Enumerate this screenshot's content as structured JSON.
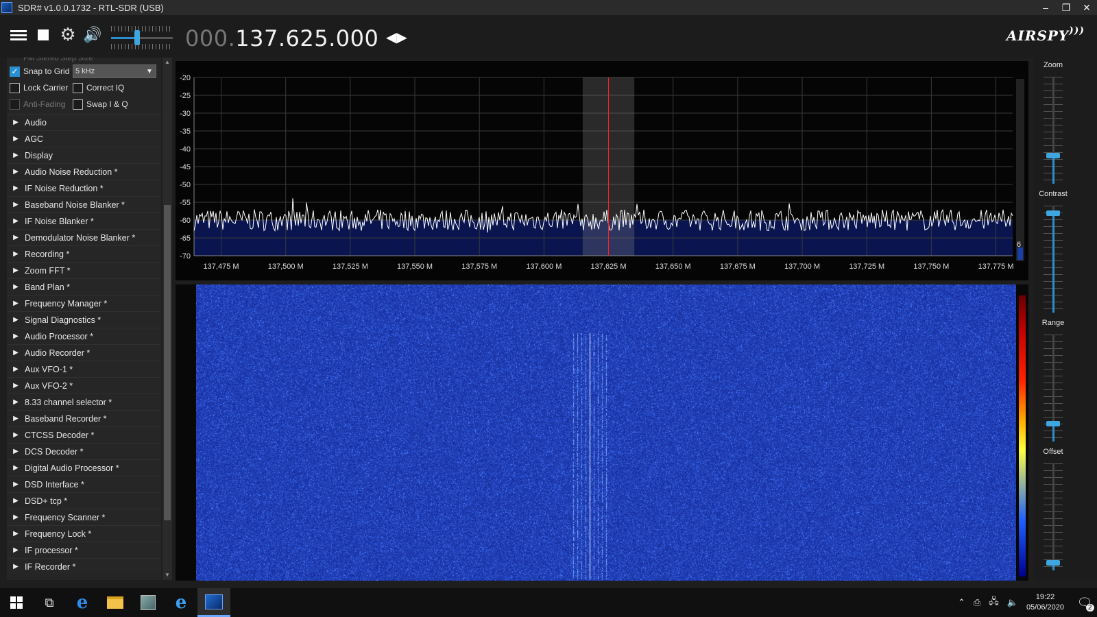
{
  "window": {
    "title": "SDR# v1.0.0.1732 - RTL-SDR (USB)",
    "minimize": "–",
    "restore": "❐",
    "close": "✕"
  },
  "toolbar": {
    "freq_dim": "000.",
    "freq_bright": "137.625.000",
    "tune_arrows": "◀▶",
    "brand": "AIRSPY",
    "volume_level": 0.42
  },
  "left": {
    "cut_labels": "FM Stereo        Step Size",
    "snap_to_grid": {
      "label": "Snap to Grid",
      "checked": true
    },
    "step_size": {
      "value": "5 kHz"
    },
    "lock_carrier": {
      "label": "Lock Carrier",
      "checked": false
    },
    "correct_iq": {
      "label": "Correct IQ",
      "checked": false
    },
    "anti_fading": {
      "label": "Anti-Fading",
      "checked": false
    },
    "swap_iq": {
      "label": "Swap I & Q",
      "checked": false
    },
    "plugins": [
      "Audio",
      "AGC",
      "Display",
      "Audio Noise Reduction *",
      "IF Noise Reduction *",
      "Baseband Noise Blanker *",
      "IF Noise Blanker *",
      "Demodulator Noise Blanker *",
      "Recording *",
      "Zoom FFT *",
      "Band Plan *",
      "Frequency Manager *",
      "Signal Diagnostics *",
      "Audio Processor *",
      "Audio Recorder *",
      "Aux VFO-1 *",
      "Aux VFO-2 *",
      "8.33 channel selector *",
      "Baseband Recorder *",
      "CTCSS Decoder *",
      "DCS Decoder *",
      "Digital Audio Processor *",
      "DSD Interface *",
      "DSD+ tcp *",
      "Frequency Scanner *",
      "Frequency Lock *",
      "IF processor *",
      "IF Recorder *"
    ]
  },
  "spectrum": {
    "y_ticks": [
      "-20",
      "-25",
      "-30",
      "-35",
      "-40",
      "-45",
      "-50",
      "-55",
      "-60",
      "-65",
      "-70"
    ],
    "x_ticks": [
      "137,475 M",
      "137,500 M",
      "137,525 M",
      "137,550 M",
      "137,575 M",
      "137,600 M",
      "137,625 M",
      "137,650 M",
      "137,675 M",
      "137,700 M",
      "137,725 M",
      "137,750 M",
      "137,775 M"
    ],
    "ylim": [
      -70,
      -20
    ],
    "xlim_mhz": [
      137.4645,
      137.7815
    ],
    "center_mhz": 137.625,
    "bandwidth_khz": 20,
    "noise_floor_db": -60,
    "scroll_value": "6"
  },
  "right": {
    "zoom_label": "Zoom",
    "contrast_label": "Contrast",
    "range_label": "Range",
    "offset_label": "Offset",
    "zoom_level": 0.25,
    "contrast_level": 0.95,
    "range_level": 0.15,
    "offset_level": 0.05
  },
  "colors": {
    "accent": "#2a8fd0",
    "waterfall_bg": "#1a2fb0",
    "spectrum_line": "#ffffff",
    "vfo_line": "#ff2020"
  },
  "taskbar": {
    "icons": [
      "windows-start-icon",
      "task-view-icon",
      "edge-icon",
      "file-explorer-icon",
      "control-panel-icon",
      "internet-explorer-icon",
      "sdrsharp-icon"
    ],
    "time": "19:22",
    "date": "05/06/2020",
    "notifications": "2"
  }
}
